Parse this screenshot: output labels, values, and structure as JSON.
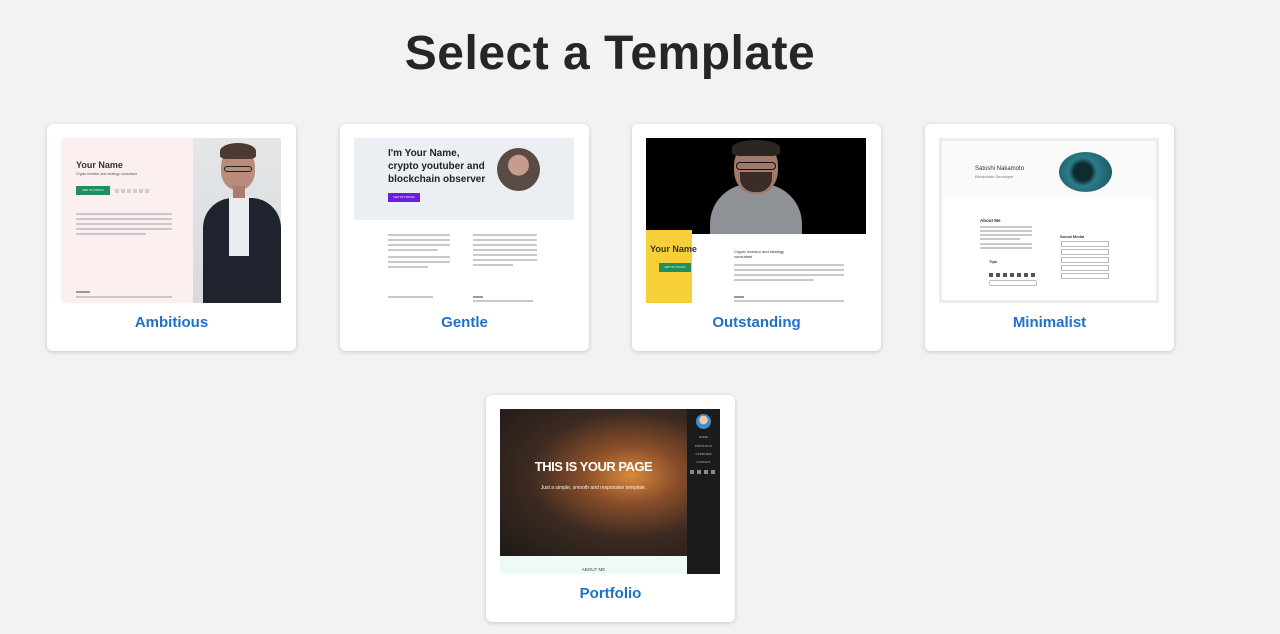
{
  "page": {
    "title": "Select a Template"
  },
  "templates": [
    {
      "name": "Ambitious",
      "preview": {
        "name": "Your Name",
        "subtitle": "Crypto investor and strategy consultant",
        "button": "GET IN TOUCH"
      }
    },
    {
      "name": "Gentle",
      "preview": {
        "headline_1": "I'm Your Name,",
        "headline_2": "crypto youtuber and",
        "headline_3": "blockchain observer",
        "button": "GET IN TOUCH"
      }
    },
    {
      "name": "Outstanding",
      "preview": {
        "name": "Your Name",
        "subtitle": "Crypto investor and strategy consultant",
        "button": "GET IN TOUCH"
      }
    },
    {
      "name": "Minimalist",
      "preview": {
        "name": "Satoshi Nakamoto",
        "subtitle": "Blockchain Developer",
        "about": "About Me",
        "social": "Social Media",
        "tips": "Tips"
      }
    },
    {
      "name": "Portfolio",
      "preview": {
        "hero": "THIS IS YOUR PAGE",
        "tagline": "Just a simple, smooth and responsive template.",
        "section": "ABOUT ME",
        "nav": [
          "HOME",
          "PORTFOLIO",
          "OVERVIEW",
          "CONTACT"
        ]
      }
    }
  ],
  "colors": {
    "link": "#1f70c8",
    "title": "#262626",
    "background": "#f2f2f2"
  }
}
